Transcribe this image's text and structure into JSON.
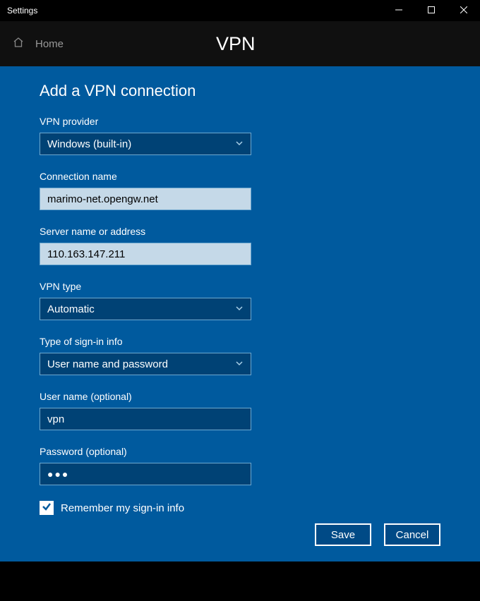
{
  "titlebar": {
    "title": "Settings"
  },
  "nav": {
    "home_label": "Home"
  },
  "page": {
    "title": "VPN"
  },
  "dialog": {
    "title": "Add a VPN connection",
    "fields": {
      "provider": {
        "label": "VPN provider",
        "value": "Windows (built-in)"
      },
      "connection_name": {
        "label": "Connection name",
        "value": "marimo-net.opengw.net"
      },
      "server": {
        "label": "Server name or address",
        "value": "110.163.147.211"
      },
      "vpn_type": {
        "label": "VPN type",
        "value": "Automatic"
      },
      "signin_type": {
        "label": "Type of sign-in info",
        "value": "User name and password"
      },
      "username": {
        "label": "User name (optional)",
        "value": "vpn"
      },
      "password": {
        "label": "Password (optional)",
        "value": "●●●"
      }
    },
    "remember": {
      "label": "Remember my sign-in info",
      "checked": true
    },
    "buttons": {
      "save": "Save",
      "cancel": "Cancel"
    }
  }
}
